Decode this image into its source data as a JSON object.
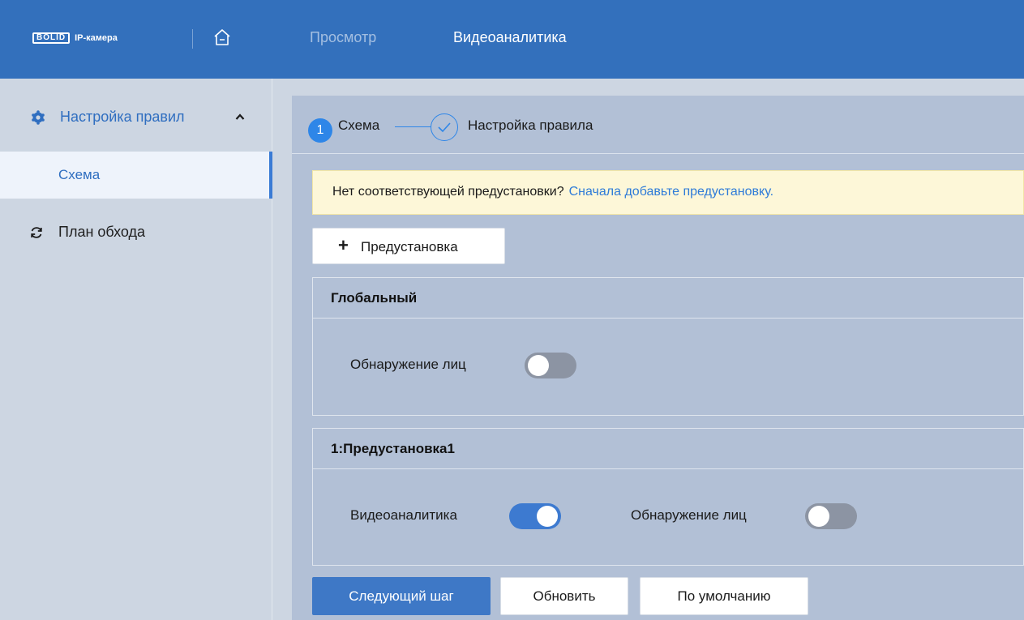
{
  "header": {
    "logo_mark": "BOLID",
    "logo_text": "IP-камера",
    "nav": [
      {
        "label": "Просмотр",
        "active": false
      },
      {
        "label": "Видеоаналитика",
        "active": true
      }
    ]
  },
  "sidebar": {
    "group": {
      "label": "Настройка правил",
      "icon": "settings-gear-icon",
      "expanded": true
    },
    "sub_items": [
      {
        "label": "Схема",
        "active": true
      }
    ],
    "items": [
      {
        "label": "План обхода",
        "icon": "refresh-icon"
      }
    ]
  },
  "steps": [
    {
      "number": "1",
      "label": "Схема",
      "state": "current"
    },
    {
      "label": "Настройка правила",
      "state": "pending"
    }
  ],
  "notice": {
    "text": "Нет соответствующей предустановки?",
    "link": "Сначала добавьте предустановку."
  },
  "add_preset_button": {
    "icon": "+",
    "label": "Предустановка"
  },
  "cards": [
    {
      "title": "Глобальный",
      "fields": [
        {
          "label": "Обнаружение лиц",
          "enabled": false
        }
      ]
    },
    {
      "title": "1:Предустановка1",
      "fields": [
        {
          "label": "Видеоаналитика",
          "enabled": true
        },
        {
          "label": "Обнаружение лиц",
          "enabled": false
        }
      ]
    }
  ],
  "buttons": {
    "next": "Следующий шаг",
    "refresh": "Обновить",
    "default": "По умолчанию"
  },
  "colors": {
    "header_bg": "#3370bc",
    "accent": "#2e86e8",
    "toggle_on": "#3d7ad0",
    "toggle_off": "#8c94a3",
    "notice_bg": "#fdf7d8"
  }
}
